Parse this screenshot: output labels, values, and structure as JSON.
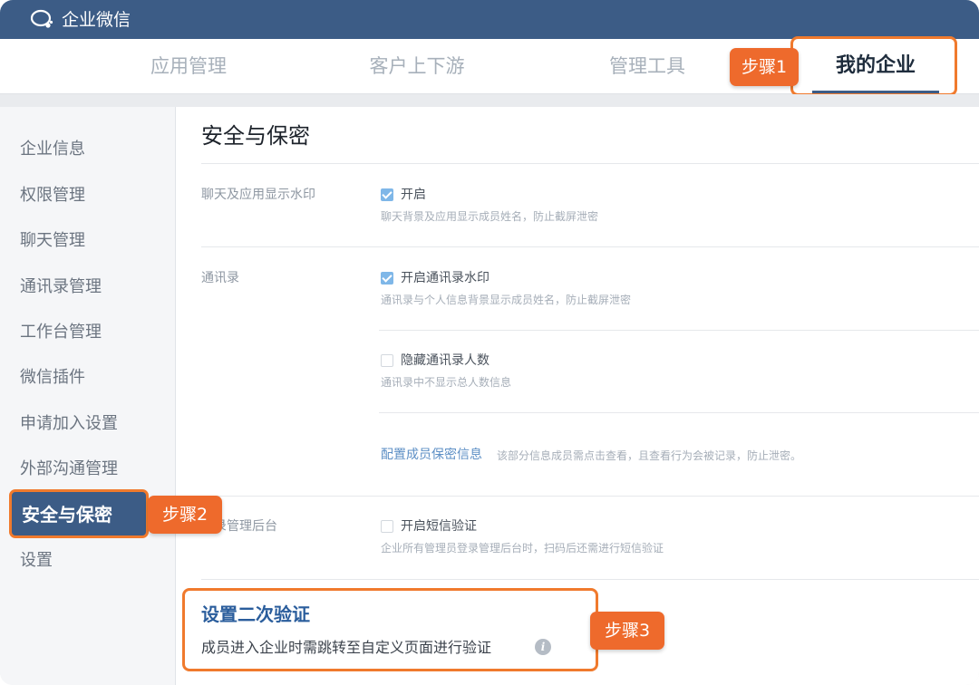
{
  "app": {
    "title": "企业微信"
  },
  "topnav": {
    "tabs": [
      {
        "label": "应用管理"
      },
      {
        "label": "客户上下游"
      },
      {
        "label": "管理工具"
      },
      {
        "label": "我的企业"
      }
    ],
    "active_tab": "我的企业"
  },
  "steps": {
    "step1": "步骤1",
    "step2": "步骤2",
    "step3": "步骤3"
  },
  "sidebar": {
    "items": [
      {
        "label": "企业信息"
      },
      {
        "label": "权限管理"
      },
      {
        "label": "聊天管理"
      },
      {
        "label": "通讯录管理"
      },
      {
        "label": "工作台管理"
      },
      {
        "label": "微信插件"
      },
      {
        "label": "申请加入设置"
      },
      {
        "label": "外部沟通管理"
      },
      {
        "label": "安全与保密"
      },
      {
        "label": "设置"
      }
    ],
    "active": "安全与保密"
  },
  "main": {
    "title": "安全与保密",
    "sections": {
      "watermark": {
        "label": "聊天及应用显示水印",
        "option": "开启",
        "checked": true,
        "desc": "聊天背景及应用显示成员姓名，防止截屏泄密"
      },
      "contacts": {
        "label": "通讯录",
        "opt1": {
          "label": "开启通讯录水印",
          "checked": true,
          "desc": "通讯录与个人信息背景显示成员姓名，防止截屏泄密"
        },
        "opt2": {
          "label": "隐藏通讯录人数",
          "checked": false,
          "desc": "通讯录中不显示总人数信息"
        },
        "link": "配置成员保密信息",
        "link_desc": "该部分信息成员需点击查看，且查看行为会被记录，防止泄密。"
      },
      "admin": {
        "label_partial": "录管理后台",
        "option": "开启短信验证",
        "checked": false,
        "desc": "企业所有管理员登录管理后台时，扫码后还需进行短信验证"
      }
    },
    "card": {
      "title": "设置二次验证",
      "desc": "成员进入企业时需跳转至自定义页面进行验证",
      "info_icon": "i"
    }
  },
  "colors": {
    "header": "#3c5c86",
    "highlight": "#f07a2d",
    "badge": "#ee6a2c",
    "link": "#5d8fc5"
  }
}
